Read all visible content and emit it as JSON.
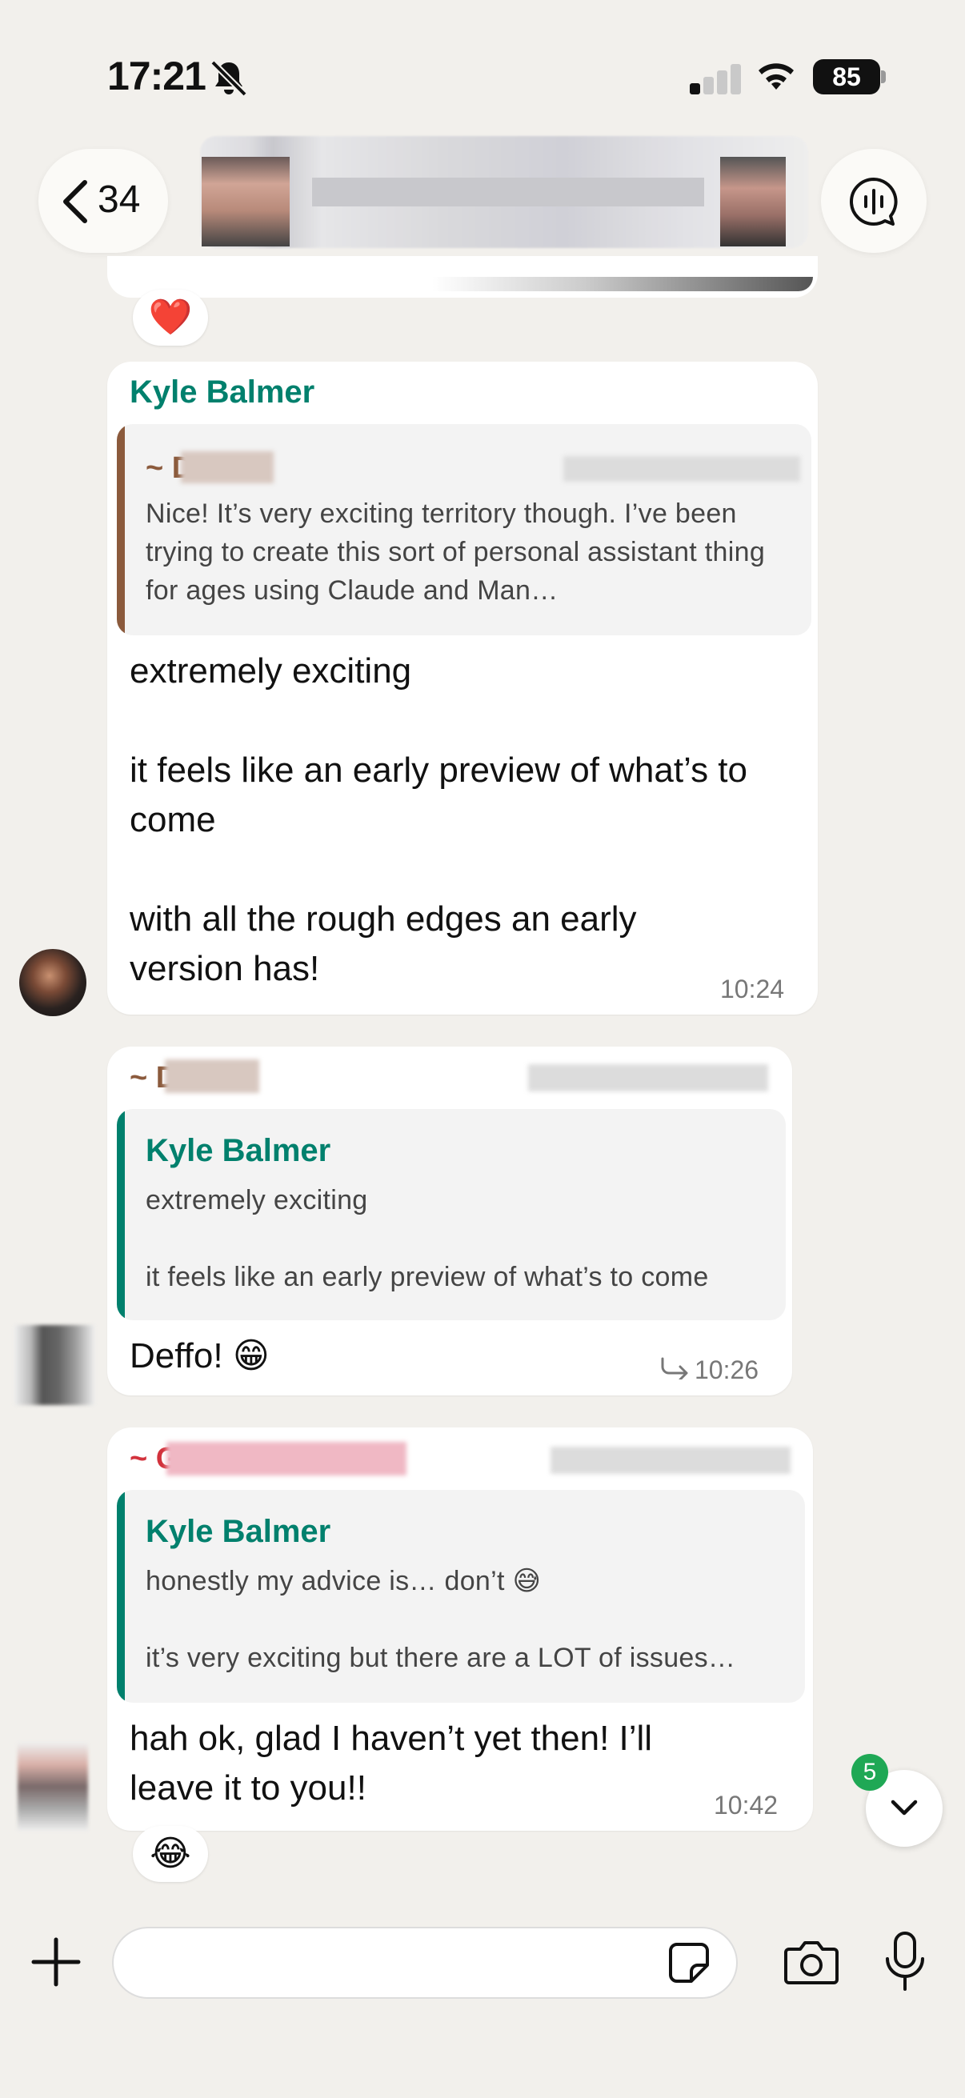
{
  "status_bar": {
    "time": "17:21",
    "battery": "85"
  },
  "header": {
    "back_count": "34"
  },
  "messages": [
    {
      "reaction": "❤️"
    },
    {
      "sender": "Kyle Balmer",
      "quote_author": "~ D",
      "quote_text": "Nice! It’s very exciting territory though. I’ve been trying to create this sort of personal assistant thing for ages using Claude and Man…",
      "lines": [
        "extremely exciting",
        "",
        "it feels like an early preview of what’s to come",
        "",
        "with all the rough edges an early version has!"
      ],
      "time": "10:24"
    },
    {
      "sender": "~ D",
      "quote_author": "Kyle Balmer",
      "quote_text_1": "extremely exciting",
      "quote_text_2": "it feels like an early preview of what’s to come",
      "text": "Deffo! 😁",
      "time": "10:26"
    },
    {
      "sender": "~ G",
      "quote_author": "Kyle Balmer",
      "quote_text_1": "honestly my advice is… don’t 😅",
      "quote_text_2": "it’s very exciting but there are a LOT of issues…",
      "text": "hah ok, glad I haven’t yet then! I’ll leave it to you!!",
      "time": "10:42",
      "reaction": "😂"
    }
  ],
  "scroll_down": {
    "unread_count": "5"
  },
  "composer": {
    "placeholder": ""
  },
  "colors": {
    "background": "#f2f0ec",
    "sender_green": "#00806d",
    "quote_brown": "#8b5a3c",
    "sender_red": "#d2323c",
    "badge_green": "#1fa855"
  }
}
